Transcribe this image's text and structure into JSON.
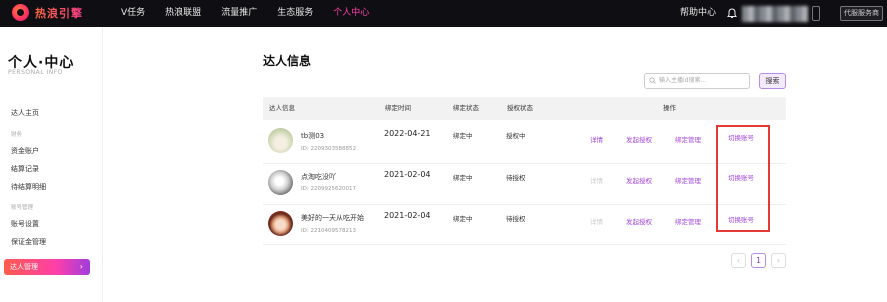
{
  "header": {
    "logo_text": "热浪引擎",
    "nav": [
      "V任务",
      "热浪联盟",
      "流量推广",
      "生态服务",
      "个人中心"
    ],
    "active_nav": "个人中心",
    "help": "帮助中心",
    "btn1": "",
    "btn2": "代服服务商",
    "accent_color": "#ff3fa9"
  },
  "sidebar": {
    "title": "个人·中心",
    "subtitle": "PERSONAL INFO",
    "home": "达人主页",
    "group_finance": "财务",
    "finance_items": [
      "资金账户",
      "结算记录",
      "待结算明细"
    ],
    "group_account": "账号管理",
    "account_items": [
      "账号设置",
      "保证金管理"
    ],
    "active_item": "达人管理",
    "active_arrow": "›"
  },
  "main": {
    "title": "达人信息",
    "search_placeholder": "输入主播id搜索...",
    "search_button": "搜索",
    "columns": [
      "达人信息",
      "绑定时间",
      "绑定状态",
      "授权状态",
      "操作"
    ],
    "rows": [
      {
        "name": "tb测03",
        "id": "ID: 2209303588852",
        "bind_time": "2022-04-21",
        "bind_status": "绑定中",
        "auth_status": "授权中",
        "detail": "详情",
        "detail_disabled": false,
        "authorize": "发起授权",
        "manage": "绑定管理",
        "switch": "切换账号"
      },
      {
        "name": "点淘吃没吖",
        "id": "ID: 2209925620017",
        "bind_time": "2021-02-04",
        "bind_status": "绑定中",
        "auth_status": "待授权",
        "detail": "详情",
        "detail_disabled": true,
        "authorize": "发起授权",
        "manage": "绑定管理",
        "switch": "切换账号"
      },
      {
        "name": "美好的一天从吃开始",
        "id": "ID: 2210409578213",
        "bind_time": "2021-02-04",
        "bind_status": "绑定中",
        "auth_status": "待授权",
        "detail": "详情",
        "detail_disabled": true,
        "authorize": "发起授权",
        "manage": "绑定管理",
        "switch": "切换账号"
      }
    ],
    "pagination": {
      "prev": "‹",
      "current": "1",
      "next": "›"
    }
  }
}
